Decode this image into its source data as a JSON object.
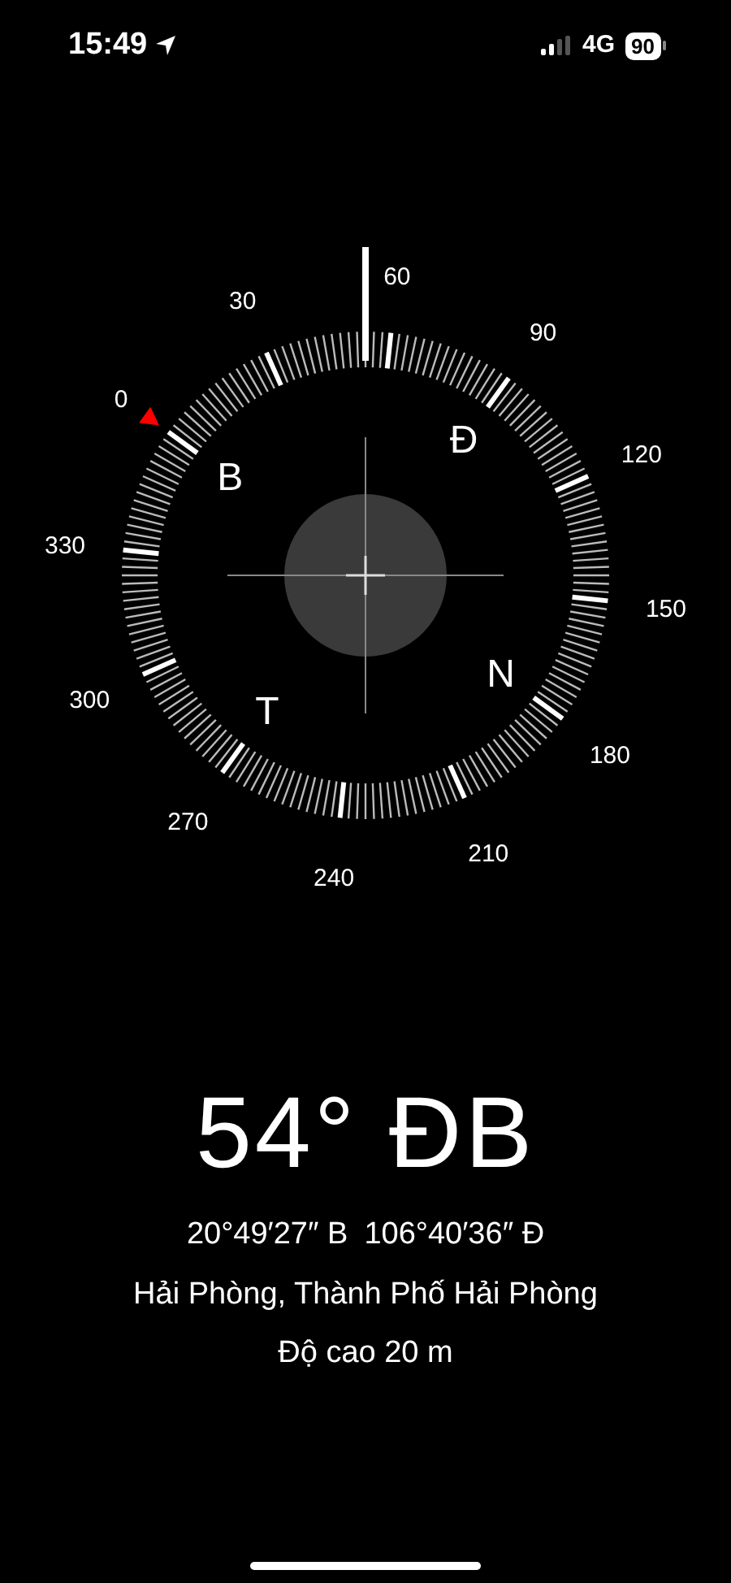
{
  "status_bar": {
    "time": "15:49",
    "network": "4G",
    "battery": "90"
  },
  "compass": {
    "degree_labels": [
      "0",
      "30",
      "60",
      "90",
      "120",
      "150",
      "180",
      "210",
      "240",
      "270",
      "300",
      "330"
    ],
    "cardinals": [
      "B",
      "Đ",
      "N",
      "T"
    ]
  },
  "heading": "54° ĐB",
  "coordinates": [
    "20°49′27″ B",
    "106°40′36″ Đ"
  ],
  "location": "Hải Phòng, Thành Phố Hải Phòng",
  "altitude": "Độ cao 20 m"
}
